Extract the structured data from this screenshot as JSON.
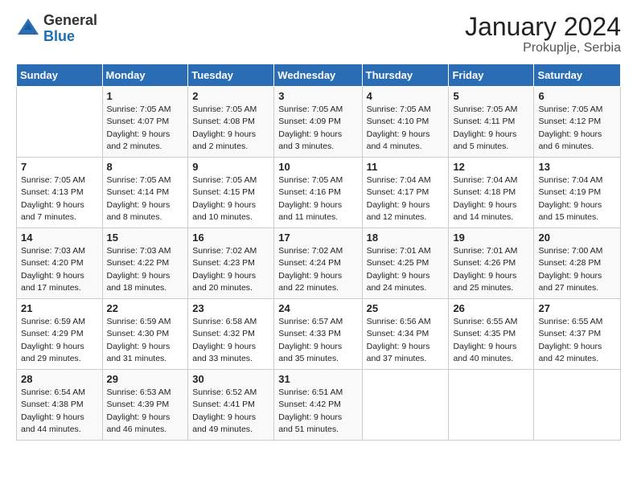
{
  "header": {
    "logo_general": "General",
    "logo_blue": "Blue",
    "month_title": "January 2024",
    "location": "Prokuplje, Serbia"
  },
  "weekdays": [
    "Sunday",
    "Monday",
    "Tuesday",
    "Wednesday",
    "Thursday",
    "Friday",
    "Saturday"
  ],
  "weeks": [
    [
      {
        "day": "",
        "info": ""
      },
      {
        "day": "1",
        "info": "Sunrise: 7:05 AM\nSunset: 4:07 PM\nDaylight: 9 hours\nand 2 minutes."
      },
      {
        "day": "2",
        "info": "Sunrise: 7:05 AM\nSunset: 4:08 PM\nDaylight: 9 hours\nand 2 minutes."
      },
      {
        "day": "3",
        "info": "Sunrise: 7:05 AM\nSunset: 4:09 PM\nDaylight: 9 hours\nand 3 minutes."
      },
      {
        "day": "4",
        "info": "Sunrise: 7:05 AM\nSunset: 4:10 PM\nDaylight: 9 hours\nand 4 minutes."
      },
      {
        "day": "5",
        "info": "Sunrise: 7:05 AM\nSunset: 4:11 PM\nDaylight: 9 hours\nand 5 minutes."
      },
      {
        "day": "6",
        "info": "Sunrise: 7:05 AM\nSunset: 4:12 PM\nDaylight: 9 hours\nand 6 minutes."
      }
    ],
    [
      {
        "day": "7",
        "info": "Sunrise: 7:05 AM\nSunset: 4:13 PM\nDaylight: 9 hours\nand 7 minutes."
      },
      {
        "day": "8",
        "info": "Sunrise: 7:05 AM\nSunset: 4:14 PM\nDaylight: 9 hours\nand 8 minutes."
      },
      {
        "day": "9",
        "info": "Sunrise: 7:05 AM\nSunset: 4:15 PM\nDaylight: 9 hours\nand 10 minutes."
      },
      {
        "day": "10",
        "info": "Sunrise: 7:05 AM\nSunset: 4:16 PM\nDaylight: 9 hours\nand 11 minutes."
      },
      {
        "day": "11",
        "info": "Sunrise: 7:04 AM\nSunset: 4:17 PM\nDaylight: 9 hours\nand 12 minutes."
      },
      {
        "day": "12",
        "info": "Sunrise: 7:04 AM\nSunset: 4:18 PM\nDaylight: 9 hours\nand 14 minutes."
      },
      {
        "day": "13",
        "info": "Sunrise: 7:04 AM\nSunset: 4:19 PM\nDaylight: 9 hours\nand 15 minutes."
      }
    ],
    [
      {
        "day": "14",
        "info": "Sunrise: 7:03 AM\nSunset: 4:20 PM\nDaylight: 9 hours\nand 17 minutes."
      },
      {
        "day": "15",
        "info": "Sunrise: 7:03 AM\nSunset: 4:22 PM\nDaylight: 9 hours\nand 18 minutes."
      },
      {
        "day": "16",
        "info": "Sunrise: 7:02 AM\nSunset: 4:23 PM\nDaylight: 9 hours\nand 20 minutes."
      },
      {
        "day": "17",
        "info": "Sunrise: 7:02 AM\nSunset: 4:24 PM\nDaylight: 9 hours\nand 22 minutes."
      },
      {
        "day": "18",
        "info": "Sunrise: 7:01 AM\nSunset: 4:25 PM\nDaylight: 9 hours\nand 24 minutes."
      },
      {
        "day": "19",
        "info": "Sunrise: 7:01 AM\nSunset: 4:26 PM\nDaylight: 9 hours\nand 25 minutes."
      },
      {
        "day": "20",
        "info": "Sunrise: 7:00 AM\nSunset: 4:28 PM\nDaylight: 9 hours\nand 27 minutes."
      }
    ],
    [
      {
        "day": "21",
        "info": "Sunrise: 6:59 AM\nSunset: 4:29 PM\nDaylight: 9 hours\nand 29 minutes."
      },
      {
        "day": "22",
        "info": "Sunrise: 6:59 AM\nSunset: 4:30 PM\nDaylight: 9 hours\nand 31 minutes."
      },
      {
        "day": "23",
        "info": "Sunrise: 6:58 AM\nSunset: 4:32 PM\nDaylight: 9 hours\nand 33 minutes."
      },
      {
        "day": "24",
        "info": "Sunrise: 6:57 AM\nSunset: 4:33 PM\nDaylight: 9 hours\nand 35 minutes."
      },
      {
        "day": "25",
        "info": "Sunrise: 6:56 AM\nSunset: 4:34 PM\nDaylight: 9 hours\nand 37 minutes."
      },
      {
        "day": "26",
        "info": "Sunrise: 6:55 AM\nSunset: 4:35 PM\nDaylight: 9 hours\nand 40 minutes."
      },
      {
        "day": "27",
        "info": "Sunrise: 6:55 AM\nSunset: 4:37 PM\nDaylight: 9 hours\nand 42 minutes."
      }
    ],
    [
      {
        "day": "28",
        "info": "Sunrise: 6:54 AM\nSunset: 4:38 PM\nDaylight: 9 hours\nand 44 minutes."
      },
      {
        "day": "29",
        "info": "Sunrise: 6:53 AM\nSunset: 4:39 PM\nDaylight: 9 hours\nand 46 minutes."
      },
      {
        "day": "30",
        "info": "Sunrise: 6:52 AM\nSunset: 4:41 PM\nDaylight: 9 hours\nand 49 minutes."
      },
      {
        "day": "31",
        "info": "Sunrise: 6:51 AM\nSunset: 4:42 PM\nDaylight: 9 hours\nand 51 minutes."
      },
      {
        "day": "",
        "info": ""
      },
      {
        "day": "",
        "info": ""
      },
      {
        "day": "",
        "info": ""
      }
    ]
  ]
}
